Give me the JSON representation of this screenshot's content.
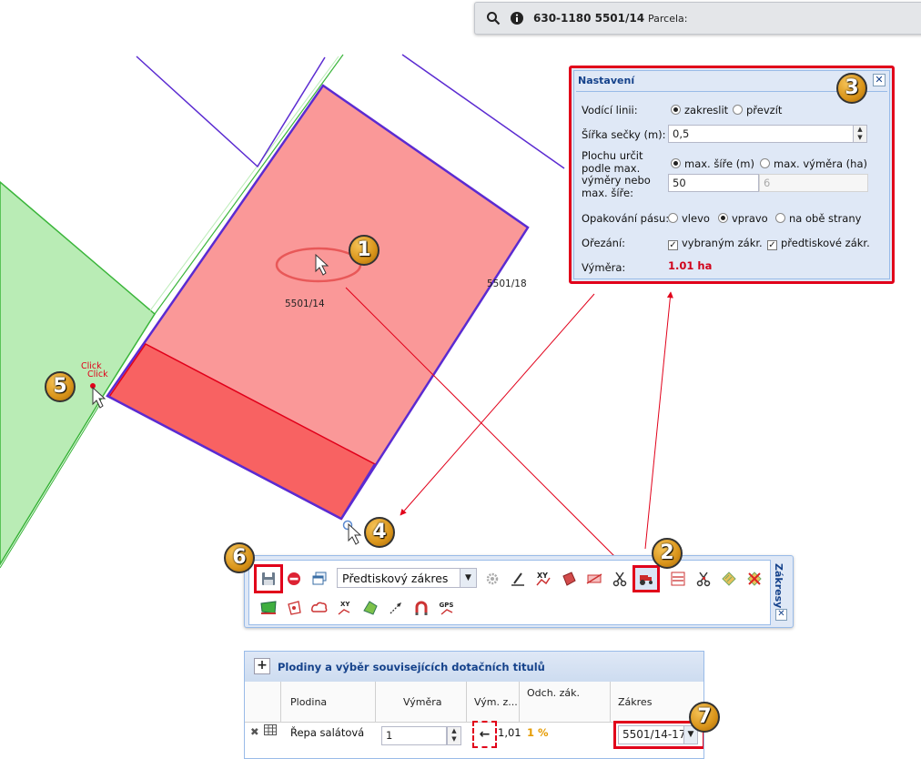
{
  "topbar": {
    "code": "630-1180 5501/14",
    "parcel_label": "Parcela:"
  },
  "map": {
    "parcel_main_label": "5501/14",
    "parcel_right_label": "5501/18",
    "click_text_1": "Click",
    "click_text_2": "Click"
  },
  "badges": [
    "1",
    "2",
    "3",
    "4",
    "5",
    "6",
    "7"
  ],
  "settings": {
    "title": "Nastavení",
    "close": "✕",
    "guide_lines_label": "Vodící linii:",
    "guide_opt_draw": "zakreslit",
    "guide_opt_take": "převzít",
    "guide_selected": "zakreslit",
    "width_label": "Šířka sečky (m):",
    "width_value": "0,5",
    "area_label_lines": [
      "Plochu určit",
      "podle max.",
      "výměry nebo",
      "max. šíře:"
    ],
    "area_opt_width": "max. šíře (m)",
    "area_opt_area": "max. výměra (ha)",
    "area_selected": "max. šíře (m)",
    "area_width_value": "50",
    "area_area_value": "6",
    "repeat_label": "Opakování pásu:",
    "repeat_left": "vlevo",
    "repeat_right": "vpravo",
    "repeat_both": "na obě strany",
    "repeat_selected": "vpravo",
    "trim_label": "Ořezání:",
    "trim_selected": "vybraným zákr.",
    "trim_preprint": "předtiskové zákr.",
    "area_result_label": "Výměra:",
    "area_result_value": "1.01 ha",
    "accent_color": "#e1001a"
  },
  "toolbar": {
    "title": "Zákresy",
    "combo_value": "Předtiskový zákres",
    "close": "✕",
    "icons_row1": [
      "save-icon",
      "cancel-icon",
      "window-icon",
      "gear-icon",
      "edit-line-icon",
      "xy-icon",
      "parcel-split-icon",
      "parcel-trim-icon",
      "scissors-icon",
      "tractor-icon",
      "strip-icon",
      "scissors-red-icon",
      "hatch-icon",
      "delete-hatch-icon"
    ],
    "icons_row2": [
      "parcel-green-icon",
      "move-point-icon",
      "cloud-icon",
      "xy-point-icon",
      "polygon-green-icon",
      "arrow-icon",
      "magnet-icon",
      "gps-icon"
    ],
    "gps_text": "GPS"
  },
  "grid": {
    "title": "Plodiny a výběr souvisejících dotačních titulů",
    "add": "+",
    "columns": [
      "Plodina",
      "Výměra",
      "Vým. z...",
      "Odch. zák.",
      "Zákres"
    ],
    "row": {
      "crop": "Řepa salátová",
      "area": "1",
      "vym_z": "1,01",
      "deviation": "1 %",
      "drawing": "5501/14-17"
    }
  }
}
